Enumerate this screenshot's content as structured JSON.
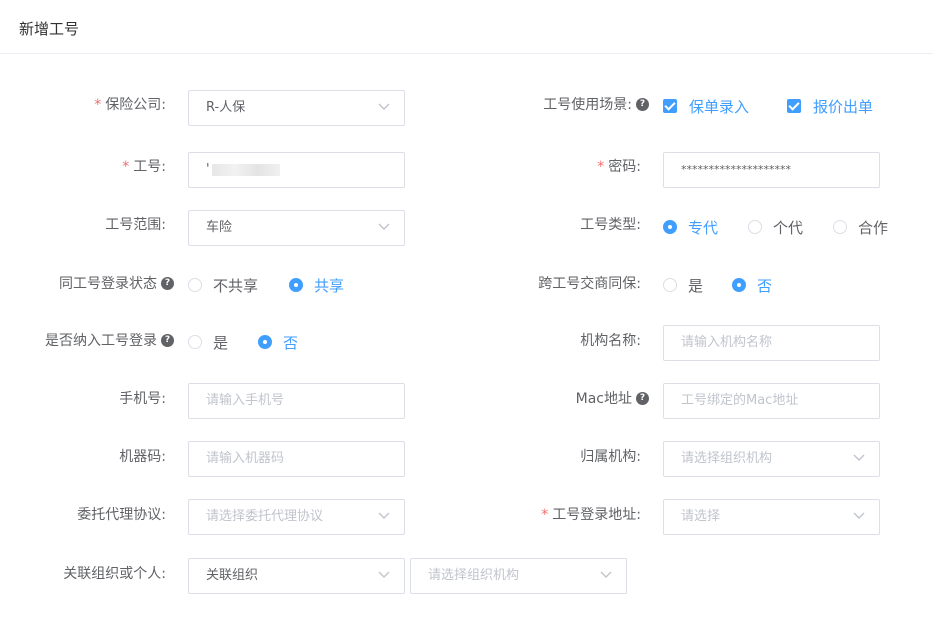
{
  "header": {
    "title": "新增工号"
  },
  "form": {
    "insurer": {
      "label": "保险公司:",
      "value": "R-人保"
    },
    "scene": {
      "label": "工号使用场景:",
      "options": [
        "保单录入",
        "报价出单"
      ]
    },
    "account": {
      "label": "工号:",
      "value": "'"
    },
    "password": {
      "label": "密码:",
      "value": "********************"
    },
    "scope": {
      "label": "工号范围:",
      "value": "车险"
    },
    "type": {
      "label": "工号类型:",
      "options": [
        "专代",
        "个代",
        "合作"
      ]
    },
    "login_state": {
      "label": "同工号登录状态",
      "options": [
        "不共享",
        "共享"
      ]
    },
    "cross_guarantee": {
      "label": "跨工号交商同保:",
      "options": [
        "是",
        "否"
      ]
    },
    "include_login": {
      "label": "是否纳入工号登录",
      "options": [
        "是",
        "否"
      ]
    },
    "org_name": {
      "label": "机构名称:",
      "placeholder": "请输入机构名称"
    },
    "phone": {
      "label": "手机号:",
      "placeholder": "请输入手机号"
    },
    "mac": {
      "label": "Mac地址",
      "placeholder": "工号绑定的Mac地址"
    },
    "machine": {
      "label": "机器码:",
      "placeholder": "请输入机器码"
    },
    "belong_org": {
      "label": "归属机构:",
      "placeholder": "请选择组织机构"
    },
    "agreement": {
      "label": "委托代理协议:",
      "placeholder": "请选择委托代理协议"
    },
    "login_addr": {
      "label": "工号登录地址:",
      "placeholder": "请选择"
    },
    "relate": {
      "label": "关联组织或个人:",
      "value": "关联组织",
      "placeholder": "请选择组织机构"
    }
  },
  "icons": {
    "help": "question-circle-icon",
    "chevron": "chevron-down-icon",
    "check": "check-icon"
  },
  "colors": {
    "accent": "#409eff",
    "required": "#f56c6c",
    "border": "#dcdfe6",
    "placeholder": "#c0c4cc"
  }
}
